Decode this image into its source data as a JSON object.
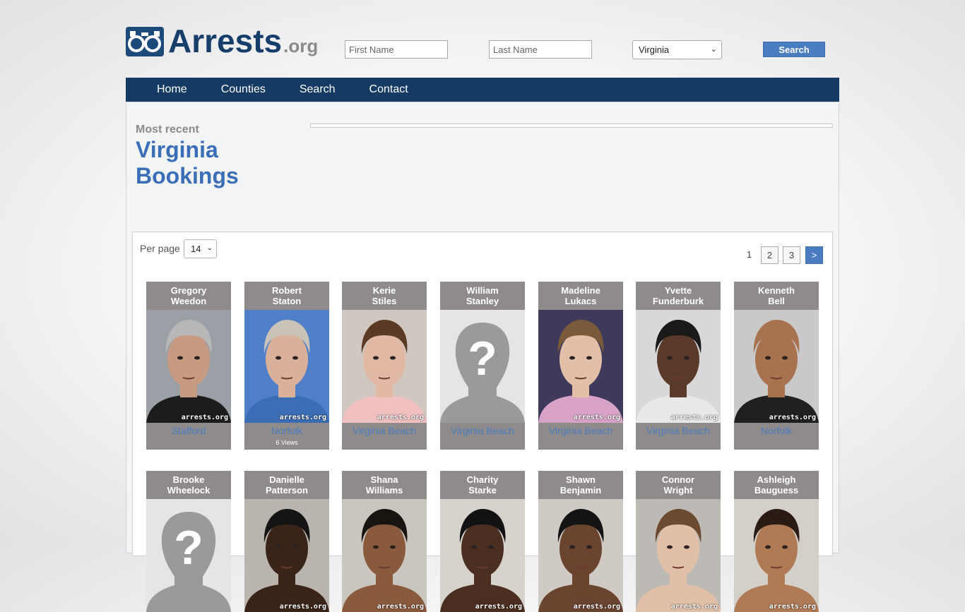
{
  "logo": {
    "name": "Arrests",
    "ext": ".org"
  },
  "search": {
    "first_placeholder": "First Name",
    "last_placeholder": "Last Name",
    "state": "Virginia",
    "button": "Search"
  },
  "nav": [
    "Home",
    "Counties",
    "Search",
    "Contact"
  ],
  "heading": {
    "kicker": "Most recent",
    "title": "Virginia Bookings"
  },
  "controls": {
    "per_page_label": "Per page",
    "per_page": "14"
  },
  "pagination": {
    "current": "1",
    "pages": [
      "2",
      "3"
    ],
    "next": ">"
  },
  "watermark": "arrests.org",
  "bookings_row1": [
    {
      "first": "Gregory",
      "last": "Weedon",
      "county": "Stafford",
      "views": "",
      "skin": "#c79a82",
      "bg": "#9aa0a6",
      "shirt": "#1c1c1c",
      "hair": "#b8b8b8",
      "placeholder": false
    },
    {
      "first": "Robert",
      "last": "Staton",
      "county": "Norfolk",
      "views": "6 Views",
      "skin": "#d9b09a",
      "bg": "#4f7fc8",
      "shirt": "#3a6db3",
      "hair": "#c9c2b8",
      "placeholder": false
    },
    {
      "first": "Kerie",
      "last": "Stiles",
      "county": "Virginia Beach",
      "views": "",
      "skin": "#e0b8a4",
      "bg": "#cfc7c0",
      "shirt": "#f0c0c0",
      "hair": "#5a3a24",
      "placeholder": false
    },
    {
      "first": "William",
      "last": "Stanley",
      "county": "Virginia Beach",
      "views": "",
      "skin": "",
      "bg": "",
      "shirt": "",
      "hair": "",
      "placeholder": true
    },
    {
      "first": "Madeline",
      "last": "Lukacs",
      "county": "Virginia Beach",
      "views": "",
      "skin": "#e4bfa8",
      "bg": "#3d3a5c",
      "shirt": "#d9a3c8",
      "hair": "#7a5a3a",
      "placeholder": false
    },
    {
      "first": "Yvette",
      "last": "Funderburk",
      "county": "Virginia Beach",
      "views": "",
      "skin": "#5a3a2a",
      "bg": "#d8d8da",
      "shirt": "#e8e8e8",
      "hair": "#1a1a1a",
      "placeholder": false
    },
    {
      "first": "Kenneth",
      "last": "Bell",
      "county": "Norfolk",
      "views": "",
      "skin": "#a8724e",
      "bg": "#c9c9c9",
      "shirt": "#202020",
      "hair": "#a8724e",
      "placeholder": false
    }
  ],
  "bookings_row2": [
    {
      "first": "Brooke",
      "last": "Wheelock",
      "placeholder": true,
      "skin": "",
      "bg": "",
      "hair": ""
    },
    {
      "first": "Danielle",
      "last": "Patterson",
      "placeholder": false,
      "skin": "#3a2418",
      "bg": "#b9b4ad",
      "hair": "#141414"
    },
    {
      "first": "Shana",
      "last": "Williams",
      "placeholder": false,
      "skin": "#8a5a3c",
      "bg": "#c9c5bf",
      "hair": "#1a1410"
    },
    {
      "first": "Charity",
      "last": "Starke",
      "placeholder": false,
      "skin": "#4a2e20",
      "bg": "#d6d2cc",
      "hair": "#121212"
    },
    {
      "first": "Shawn",
      "last": "Benjamin",
      "placeholder": false,
      "skin": "#6b4430",
      "bg": "#cfcac4",
      "hair": "#141414"
    },
    {
      "first": "Connor",
      "last": "Wright",
      "placeholder": false,
      "skin": "#e2c0a8",
      "bg": "#bdbab5",
      "hair": "#6b4a30"
    },
    {
      "first": "Ashleigh",
      "last": "Bauguess",
      "placeholder": false,
      "skin": "#b07a54",
      "bg": "#d3cfc9",
      "hair": "#2a1c14"
    }
  ]
}
